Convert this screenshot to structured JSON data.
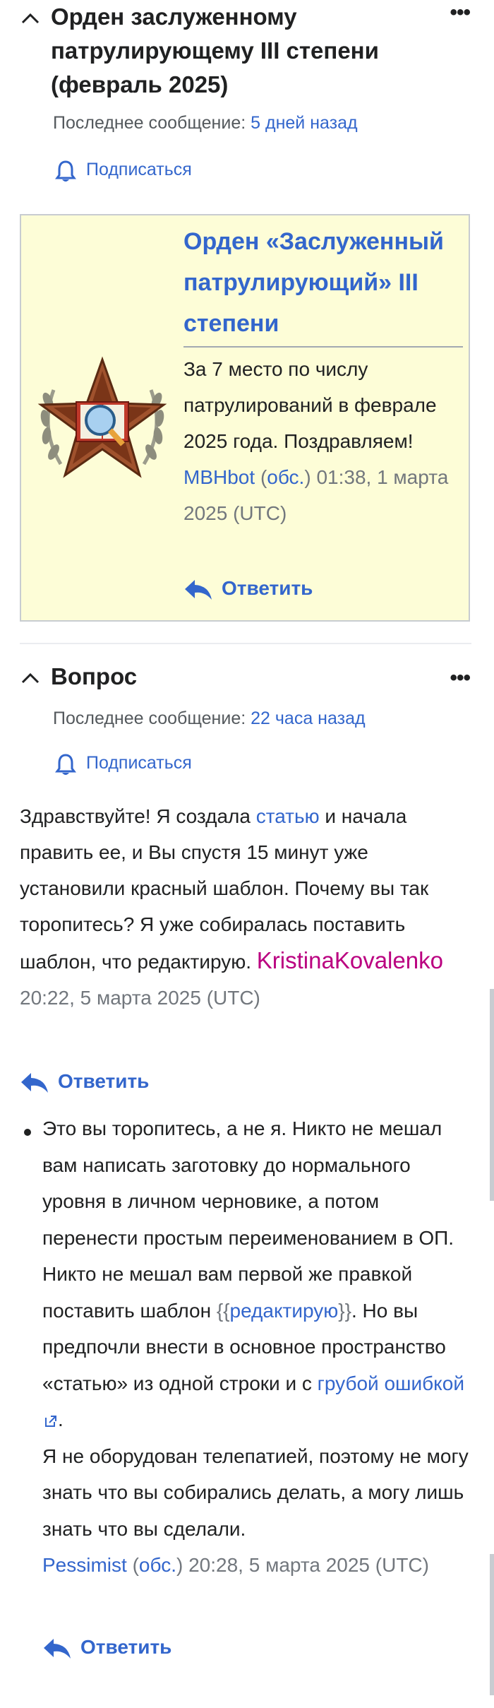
{
  "topic1": {
    "title": "Орден заслуженному патрулирующему III степени (февраль 2025)",
    "last_message_label": "Последнее сообщение: ",
    "last_message_time": "5 дней назад",
    "subscribe_label": "Подписаться",
    "award": {
      "title": "Орден «Заслуженный патрулирующий» III степени",
      "text": "За 7 место по числу патрулирований в феврале 2025 года. Поздравляем! ",
      "signature_user": "MBHbot",
      "signature_talk_open": "(",
      "signature_talk": "обс.",
      "signature_talk_close": ")",
      "signature_time": " 01:38, 1 марта 2025 (UTC)",
      "reply_label": "Ответить"
    }
  },
  "topic2": {
    "title": "Вопрос",
    "last_message_label": "Последнее сообщение: ",
    "last_message_time": "22 часа назад",
    "subscribe_label": "Подписаться",
    "post": {
      "text_before": "Здравствуйте! Я создала ",
      "link": "статью",
      "text_after": " и начала править ее, и Вы спустя 15 минут уже установили красный шаблон. Почему вы так торопитесь? Я уже собиралась поставить шаблон, что редактирую.",
      "user": "KristinaKovalenko",
      "time": " 20:22, 5 марта 2025 (UTC)",
      "reply_label": "Ответить"
    },
    "answer": {
      "part1": "Это вы торопитесь, а не я. Никто не мешал вам написать заготовку до нормального уровня в личном черновике, а потом перенести простым переименованием в ОП. Никто не мешал вам первой же правкой поставить шаблон ",
      "tpl_open": "{{",
      "tpl_link": "редактирую",
      "tpl_close": "}}",
      "part2": ". Но вы предпочли внести в основное пространство «статью» из одной строки и с ",
      "ext_link": "грубой ошибкой",
      "part3": ".",
      "part4": "Я не оборудован телепатией, поэтому не могу знать что вы собирались делать, а могу лишь знать что вы сделали.",
      "user": "Pessimist",
      "talk_open": " (",
      "talk": "обс.",
      "talk_close": ")",
      "time": " 20:28, 5 марта 2025 (UTC)",
      "reply_label": "Ответить"
    }
  },
  "colors": {
    "link": "#3366cc",
    "user_link": "#ba0080",
    "award_bg": "#fdfdd7"
  }
}
